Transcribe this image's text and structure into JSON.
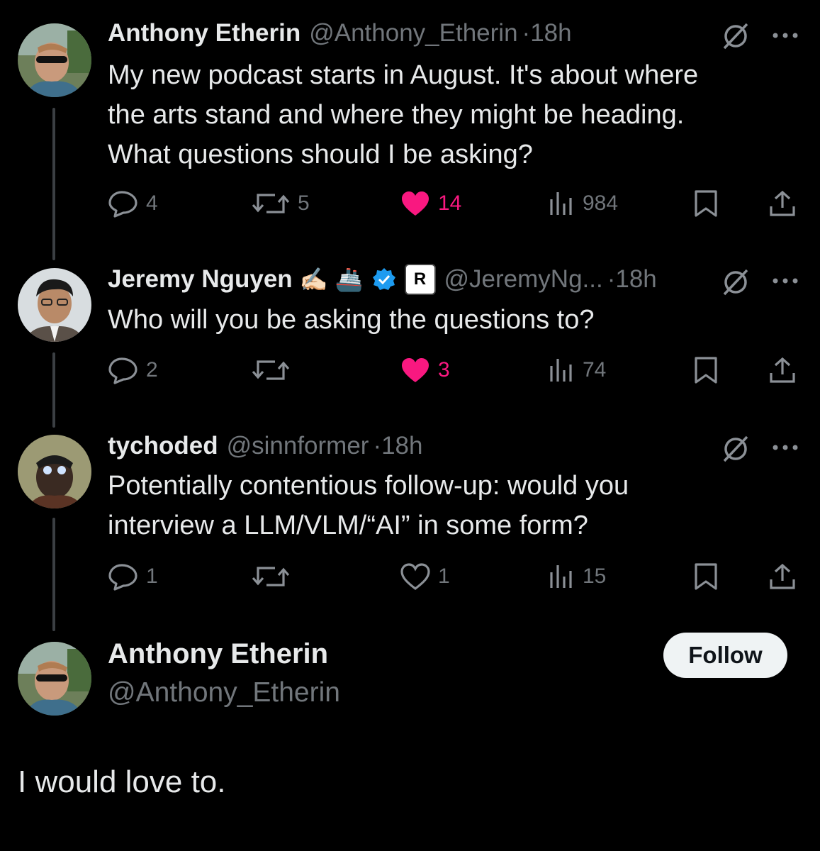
{
  "tweets": [
    {
      "name": "Anthony Etherin",
      "handle": "@Anthony_Etherin",
      "time": "18h",
      "lines": [
        "My new podcast starts in August. It's about where",
        "the arts stand and where they might be heading.",
        "What questions should I be asking?"
      ],
      "replies": "4",
      "reposts": "5",
      "likes": "14",
      "views": "984",
      "liked": true
    },
    {
      "name": "Jeremy Nguyen",
      "name_emojis": "✍🏻 🚢",
      "affiliate_badge": "R",
      "handle": "@JeremyNg...",
      "time": "18h",
      "lines": [
        "Who will you be asking the questions to?"
      ],
      "replies": "2",
      "reposts": "",
      "likes": "3",
      "views": "74",
      "liked": true
    },
    {
      "name": "tychoded",
      "handle": "@sinnformer",
      "time": "18h",
      "lines": [
        "Potentially contentious follow-up: would you",
        "interview a LLM/VLM/“AI” in some form?"
      ],
      "replies": "1",
      "reposts": "",
      "likes": "1",
      "views": "15",
      "liked": false
    }
  ],
  "main": {
    "name": "Anthony Etherin",
    "handle": "@Anthony_Etherin",
    "follow_label": "Follow",
    "text": "I would love to."
  },
  "dot": "·",
  "colors": {
    "background": "#000000",
    "text": "#e7e9ea",
    "muted": "#71767b",
    "like": "#f91880",
    "verified": "#1d9bf0"
  },
  "icons": [
    "grok-icon",
    "more-icon",
    "reply-icon",
    "repost-icon",
    "like-icon",
    "views-icon",
    "bookmark-icon",
    "share-icon",
    "verified-icon"
  ]
}
